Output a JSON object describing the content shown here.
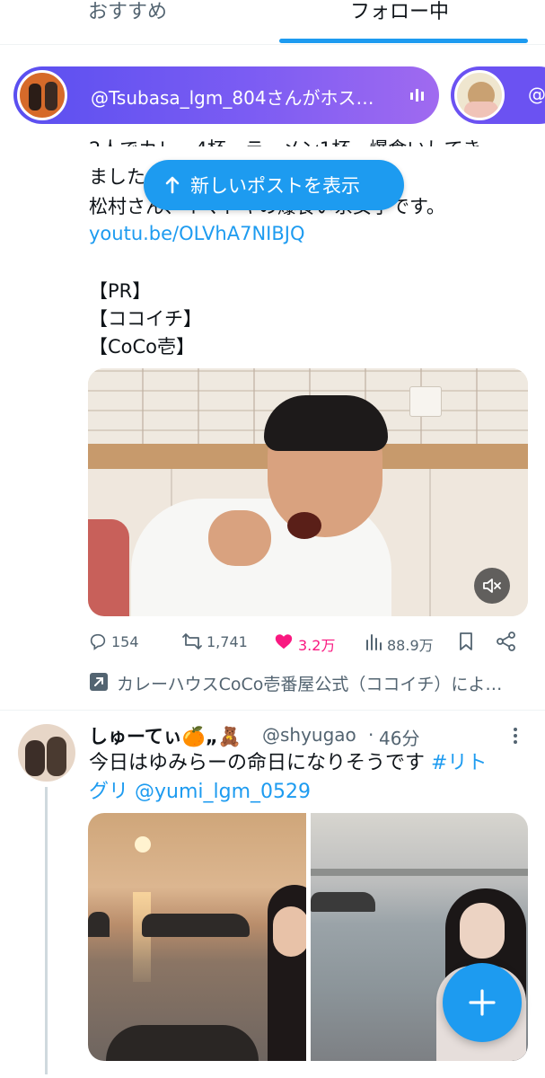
{
  "tabs": {
    "recommended": "おすすめ",
    "following": "フォロー中"
  },
  "spaces": {
    "primary_text": "@Tsubasa_lgm_804さんがホス…",
    "secondary_text": "@"
  },
  "new_posts_button": "新しいポストを表示",
  "tweet1": {
    "line1": "2人でカレー4杯、ラーメン1杯、爆食いしてき",
    "line2": "ました",
    "line3": "松村さん、イマドキの爆食い系女子です。",
    "link": "youtu.be/OLVhA7NIBJQ",
    "tag1": "【PR】",
    "tag2": "【ココイチ】",
    "tag3": "【CoCo壱】",
    "replies": "154",
    "retweets": "1,741",
    "likes": "3.2万",
    "views": "88.9万",
    "promoted_by": "カレーハウスCoCo壱番屋公式（ココイチ）によ…"
  },
  "tweet2": {
    "display_name": "しゅーてぃ🍊„🧸",
    "handle": "@shyugao",
    "dot": "·",
    "time": "46分",
    "text_line1": "今日はゆみらーの命日になりそうです ",
    "hashtag_part1": "#リト",
    "text_line2": "グリ @yumi_lgm_0529"
  },
  "colors": {
    "accent": "#1d9bf0",
    "like": "#f91880",
    "secondary_text": "#536471",
    "space_gradient_start": "#5a4ff0",
    "space_gradient_end": "#a06af0"
  },
  "icons": {
    "reply": "reply-icon",
    "retweet": "retweet-icon",
    "like": "heart-icon",
    "views": "views-icon",
    "bookmark": "bookmark-icon",
    "share": "share-icon",
    "compose": "plus-icon",
    "mute": "mute-icon"
  }
}
